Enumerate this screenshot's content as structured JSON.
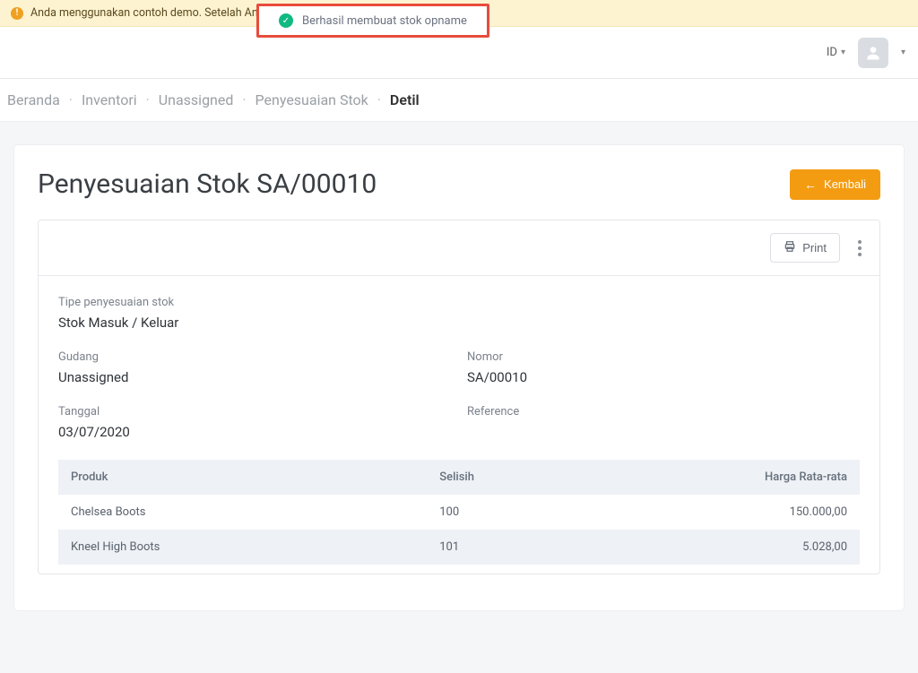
{
  "demoBanner": {
    "text": "Anda menggunakan contoh demo. Setelah An                                                         euangan perusahaan Anda"
  },
  "toast": {
    "message": "Berhasil membuat stok opname"
  },
  "topbar": {
    "language": "ID"
  },
  "breadcrumb": {
    "items": [
      "Beranda",
      "Inventori",
      "Unassigned",
      "Penyesuaian Stok",
      "Detil"
    ],
    "activeIndex": 4
  },
  "page": {
    "title": "Penyesuaian Stok SA/00010",
    "backLabel": "Kembali",
    "printLabel": "Print"
  },
  "details": {
    "adjustTypeLabel": "Tipe penyesuaian stok",
    "adjustTypeValue": "Stok Masuk / Keluar",
    "warehouseLabel": "Gudang",
    "warehouseValue": "Unassigned",
    "numberLabel": "Nomor",
    "numberValue": "SA/00010",
    "dateLabel": "Tanggal",
    "dateValue": "03/07/2020",
    "referenceLabel": "Reference",
    "referenceValue": ""
  },
  "table": {
    "headers": {
      "product": "Produk",
      "diff": "Selisih",
      "avg": "Harga Rata-rata"
    },
    "rows": [
      {
        "product": "Chelsea Boots",
        "diff": "100",
        "avg": "150.000,00"
      },
      {
        "product": "Kneel High Boots",
        "diff": "101",
        "avg": "5.028,00"
      }
    ]
  }
}
